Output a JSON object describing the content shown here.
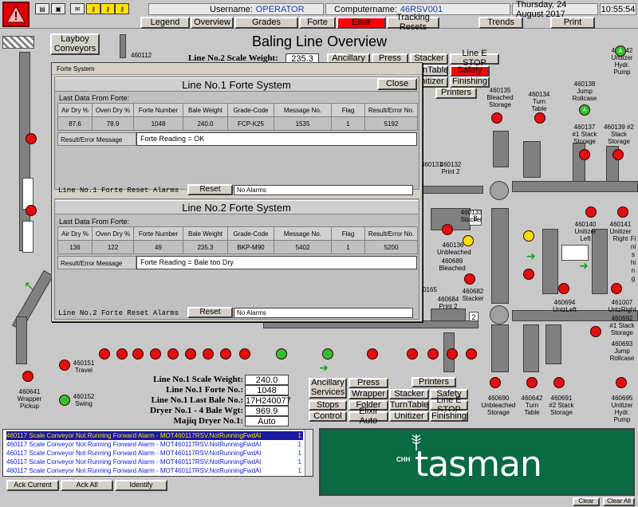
{
  "topbar": {
    "username_label": "Username:",
    "username": "OPERATOR",
    "computername_label": "Computername:",
    "computername": "46RSV001",
    "date": "Thursday, 24 August 2017",
    "time": "10:55:54",
    "nav": [
      "Legend",
      "Overview",
      "Grades",
      "Forte",
      "Elixir",
      "Tracking Resets",
      "Trends",
      "Print"
    ],
    "active_nav": "Elixir"
  },
  "main": {
    "title": "Baling Line Overview",
    "layboy": "Layboy Conveyors",
    "scale_weight_label": "Line No.2 Scale Weight:",
    "scale_weight_value": "235.3",
    "top_buttons": [
      "Ancillary",
      "Press",
      "Stacker",
      "Line E STOP",
      "TurnTable",
      "Safety",
      "Unitizer",
      "Finishing",
      "Printers"
    ],
    "equipment_labels": {
      "b460112": "460112",
      "b460135": "460135 Bleached Storage",
      "b460134": "460134 Turn Table",
      "b460138": "460138 Jump Rollcase",
      "b460139": "460139 #2 Stack Storage",
      "b460137": "460137 #1 Stack Storage",
      "b460140": "460140 Unitizer Left",
      "b460141": "460141 Unitizer Right",
      "b460142": "460142 Unitizer Hydr. Pump",
      "b460131": "460131",
      "b460132": "460132 Print 2",
      "b460133": "460133 Stacker",
      "b460136": "460136 Unbleached",
      "b460689": "460689 Bleached",
      "b460165": "0165",
      "b460684": "460684 Print 2",
      "b460682": "460682 Stacker",
      "b460694": "460694 UntzLeft",
      "b461007": "461007 UntzRight",
      "b460692": "460692 #1 Stack Storage",
      "b460693": "460693 Jump Rollcase",
      "b460690": "460690 Unbleached Storage",
      "b460642": "460642 Turn Table",
      "b460691": "460691 #2 Stack Storage",
      "b460695": "460695 Unitizer Hydr. Pump",
      "b460151": "460151 Travel",
      "b460152": "460152 Swing",
      "b460641": "460641 Wrapper Pickup",
      "finishing_vertical": "Finishing"
    },
    "stacker_nums": [
      "8",
      "2"
    ],
    "data_fields": [
      {
        "label": "Line No.1 Scale Weight:",
        "value": "240.0"
      },
      {
        "label": "Line No.1 Forte No.:",
        "value": "1048"
      },
      {
        "label": "Line No.1 Last Bale No.:",
        "value": "17H240077"
      },
      {
        "label": "Dryer No.1 - 4 Bale Wgt:",
        "value": "969.9"
      },
      {
        "label": "Majiq Dryer No.1:",
        "value": "Auto"
      }
    ],
    "bottom_buttons": [
      "Ancillary Services",
      "Press",
      "Printers",
      "Wrapper",
      "Stacker",
      "Safety",
      "Stops",
      "Folder",
      "TurnTable",
      "Line E STOP",
      "Control",
      "Elixir Auto",
      "Unitizer",
      "Finishing"
    ]
  },
  "forte": {
    "window_title": "Forte System",
    "close_label": "Close",
    "line1": {
      "title": "Line No.1 Forte System",
      "last_data_label": "Last Data From Forte:",
      "headers": [
        "Air Dry %",
        "Oven Dry %",
        "Forte Number",
        "Bale Weight",
        "Grade-Code",
        "Message No.",
        "Flag",
        "Result/Error No."
      ],
      "values": [
        "87.6",
        "78.9",
        "1048",
        "240.0",
        "FCP-K25",
        "1535",
        "1",
        "5192"
      ],
      "result_label": "Result/Error Message",
      "result_value": "Forte Reading = OK",
      "reset_label": "Line No.1 Forte Reset Alarms",
      "reset_button": "Reset",
      "alarm_value": "No Alarms"
    },
    "line2": {
      "title": "Line No.2 Forte System",
      "last_data_label": "Last Data From Forte:",
      "headers": [
        "Air Dry %",
        "Oven Dry %",
        "Forte Number",
        "Bale Weight",
        "Grade-Code",
        "Message No.",
        "Flag",
        "Result/Error No."
      ],
      "values": [
        "136",
        "122",
        "49",
        "235.3",
        "BKP-M90",
        "5402",
        "1",
        "5200"
      ],
      "result_label": "Result/Error Message",
      "result_value": "Forte Reading = Bale too Dry",
      "reset_label": "Line No.2 Forte Reset Alarms",
      "reset_button": "Reset",
      "alarm_value": "No Alarms"
    }
  },
  "alarms": {
    "rows": [
      {
        "text": "460117 Scale Conveyor Not Running Forward Alarm - MOT460117RSV.NotRunningFwdAl",
        "count": "1"
      },
      {
        "text": "460117 Scale Conveyor Not Running Forward Alarm - MOT460117RSV.NotRunningFwdAl",
        "count": "1"
      },
      {
        "text": "460117 Scale Conveyor Not Running Forward Alarm - MOT460117RSV.NotRunningFwdAl",
        "count": "1"
      },
      {
        "text": "460117 Scale Conveyor Not Running Forward Alarm - MOT460117RSV.NotRunningFwdAl",
        "count": "1"
      },
      {
        "text": "460117 Scale Conveyor Not Running Forward Alarm - MOT460117RSV.NotRunningFwdAl",
        "count": "1"
      }
    ],
    "ack_current": "Ack Current",
    "ack_all": "Ack All",
    "identify": "Identify",
    "clear": "Clear",
    "clear_all": "Clear All"
  },
  "logo": {
    "chh": "CHH",
    "brand": "tasman"
  },
  "colors": {
    "alarm_red": "#e00000",
    "motor_green": "#2ec030",
    "logo_green": "#0a6a44",
    "alarm_text": "#1020d0"
  }
}
